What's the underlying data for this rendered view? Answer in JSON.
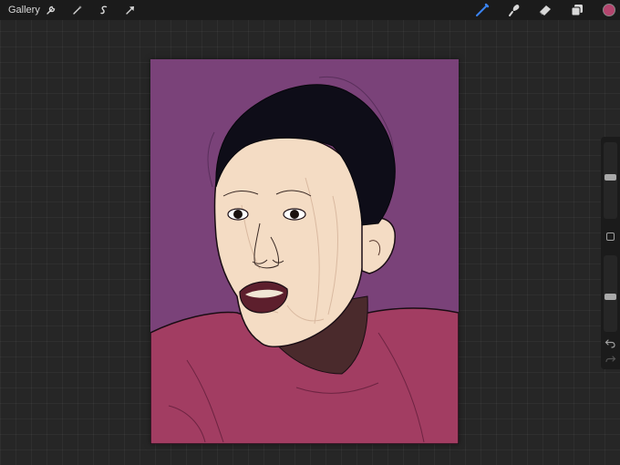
{
  "app": {
    "gallery_label": "Gallery",
    "active_color": "#b4456e",
    "brush_accent_color": "#3a83f0"
  },
  "toolbar": {
    "left_tools": [
      "wrench-icon",
      "magic-wand-icon",
      "selection-icon",
      "transform-arrow-icon"
    ],
    "right_tools": [
      "brush-icon",
      "smudge-icon",
      "eraser-icon",
      "layers-icon"
    ],
    "active_tool": "brush-icon"
  },
  "sidebar": {
    "brush_size_level": 0.55,
    "brush_opacity_level": 0.45,
    "controls": [
      "brush-size-slider",
      "modify-button",
      "brush-opacity-slider",
      "undo-icon",
      "redo-icon"
    ]
  },
  "artwork": {
    "colors": {
      "background": "#7a4279",
      "hair": "#0e0d18",
      "skin": "#f4dcc4",
      "shirt": "#a23d62",
      "neck_shadow": "#4a2a2c",
      "lips": "#5d1f2d"
    }
  }
}
